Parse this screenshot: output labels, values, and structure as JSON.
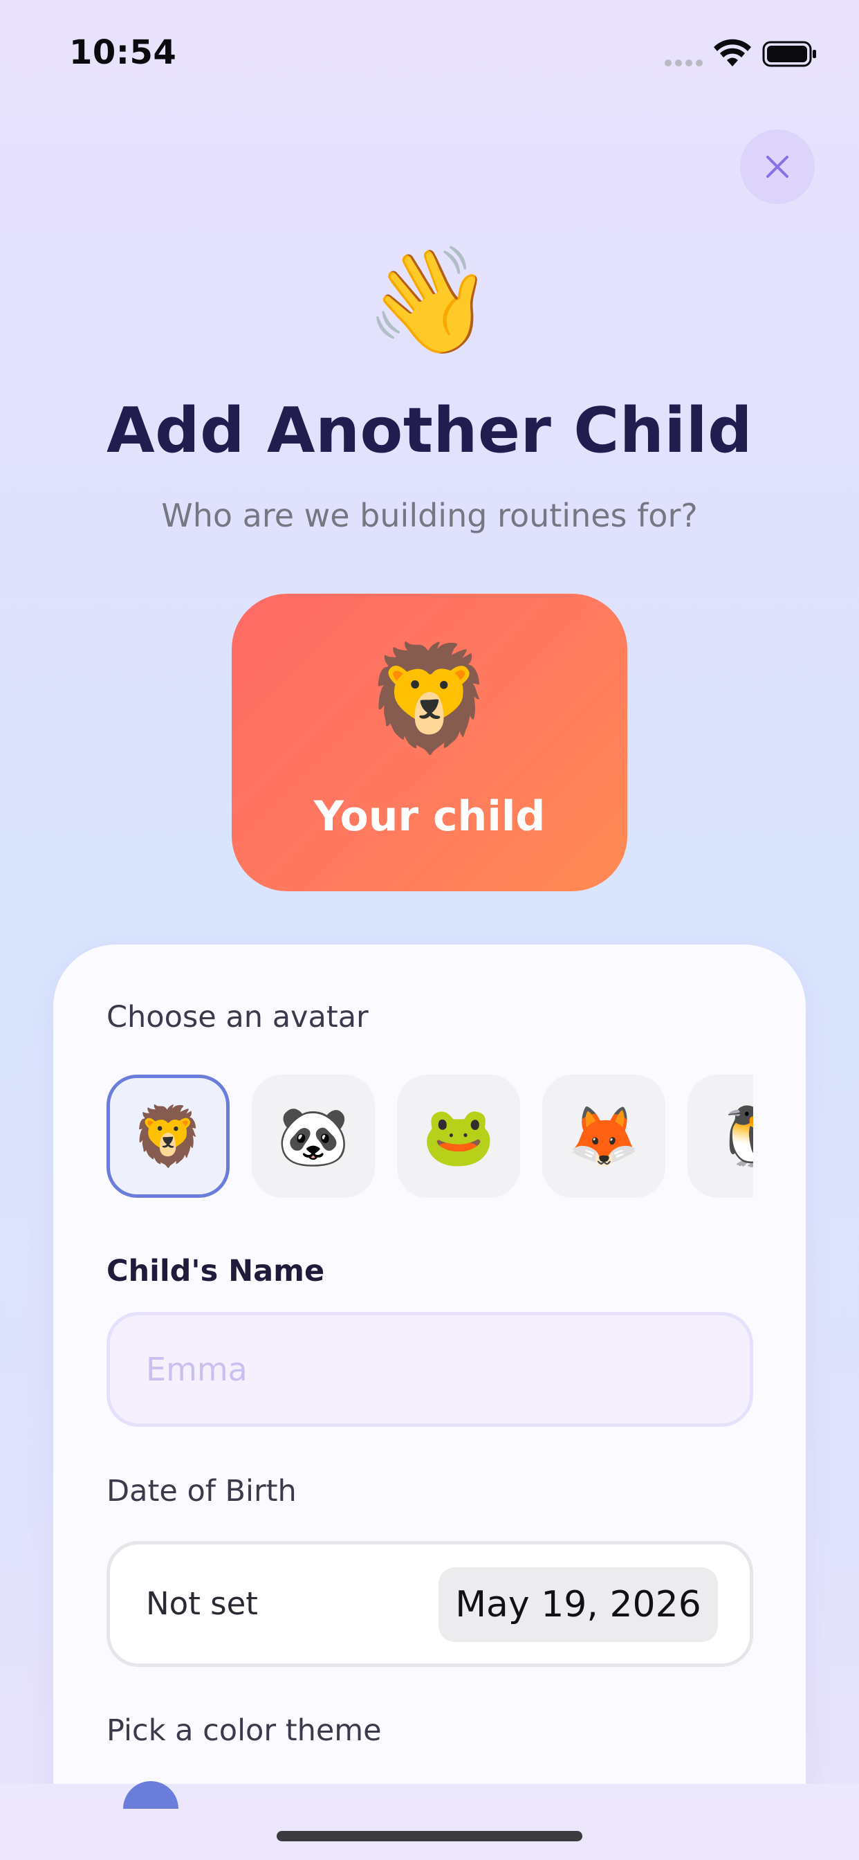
{
  "status_bar": {
    "time": "10:54"
  },
  "header": {
    "wave_emoji": "👋",
    "title": "Add Another Child",
    "subtitle": "Who are we building routines for?"
  },
  "preview_card": {
    "avatar": "🦁",
    "name": "Your child",
    "gradient_start": "#ff6b66",
    "gradient_end": "#ff8a52"
  },
  "form": {
    "avatar_label": "Choose an avatar",
    "avatars": [
      {
        "emoji": "🦁",
        "name": "lion",
        "selected": true
      },
      {
        "emoji": "🐼",
        "name": "panda",
        "selected": false
      },
      {
        "emoji": "🐸",
        "name": "frog",
        "selected": false
      },
      {
        "emoji": "🦊",
        "name": "fox",
        "selected": false
      },
      {
        "emoji": "🐧",
        "name": "penguin",
        "selected": false
      }
    ],
    "name_label": "Child's Name",
    "name_value": "",
    "name_placeholder": "Emma",
    "dob_label": "Date of Birth",
    "dob_status": "Not set",
    "dob_picker_value": "May 19, 2026",
    "color_theme_label": "Pick a color theme"
  },
  "colors": {
    "accent": "#6b7ddb",
    "title": "#221d4f",
    "close_bg": "#ddd4fb",
    "close_icon": "#8a6fe8"
  }
}
